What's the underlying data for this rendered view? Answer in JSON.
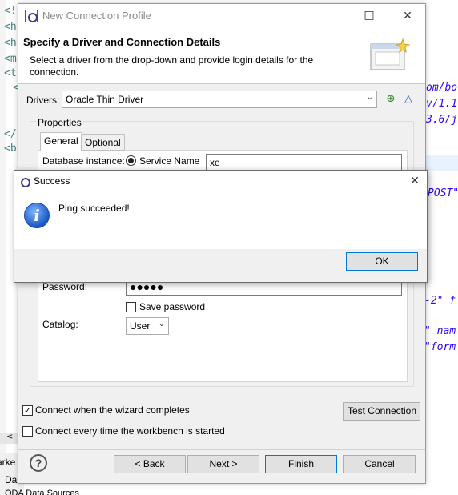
{
  "background": {
    "tags": [
      "<!",
      "<h",
      "<h",
      "<m",
      "<t",
      "<",
      "</",
      "<b"
    ],
    "code_fragments": [
      "om/bo",
      "v/1.1",
      "3.6/j",
      "POST\"",
      "-2\" f",
      "\" nam",
      "\"form"
    ],
    "bottom_labels": [
      "arke",
      "Da",
      "ODA Data Sources"
    ]
  },
  "dialog": {
    "title": "New Connection Profile",
    "minimize_icon": "□",
    "close_icon": "✕",
    "header_title": "Specify a Driver and Connection Details",
    "header_description": "Select a driver from the drop-down and provide login details for the connection.",
    "drivers_label": "Drivers:",
    "driver_value": "Oracle Thin Driver",
    "properties_label": "Properties",
    "tabs": [
      {
        "label": "General"
      },
      {
        "label": "Optional"
      }
    ],
    "database_instance_label": "Database instance:",
    "service_name_label": "Service Name",
    "service_name_value": "xe",
    "password_label": "Password:",
    "password_mask": "●●●●●",
    "save_password_label": "Save password",
    "catalog_label": "Catalog:",
    "catalog_value": "User",
    "connect_on_complete_label": "Connect when the wizard completes",
    "connect_on_start_label": "Connect every time the workbench is started",
    "test_connection_label": "Test Connection",
    "back_label": "< Back",
    "next_label": "Next >",
    "finish_label": "Finish",
    "cancel_label": "Cancel"
  },
  "popup": {
    "title": "Success",
    "close_icon": "✕",
    "message": "Ping succeeded!",
    "ok_label": "OK"
  }
}
